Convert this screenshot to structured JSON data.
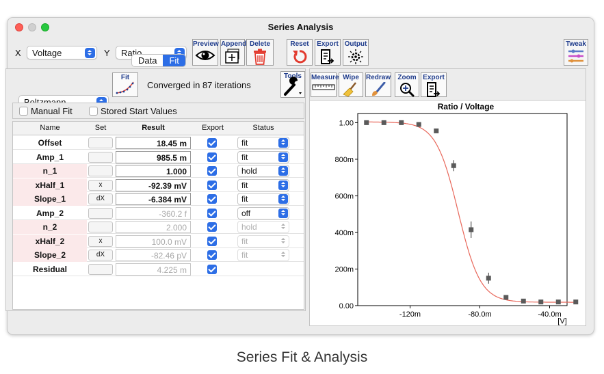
{
  "window": {
    "title": "Series Analysis"
  },
  "axes_select": {
    "x_label": "X",
    "x_value": "Voltage",
    "y_label": "Y",
    "y_value": "Ratio"
  },
  "toolbar": {
    "preview": "Preview",
    "append": "Append",
    "delete": "Delete",
    "reset": "Reset",
    "export": "Export",
    "output": "Output",
    "tweak": "Tweak"
  },
  "tabs": [
    {
      "label": "Data",
      "active": false
    },
    {
      "label": "Fit",
      "active": true
    }
  ],
  "fit": {
    "function": "Boltzmann",
    "fit_button": "Fit",
    "status": "Converged in 87 iterations",
    "tools": "Tools",
    "manual_fit": "Manual Fit",
    "stored_start": "Stored Start Values"
  },
  "table": {
    "headers": {
      "name": "Name",
      "set": "Set",
      "result": "Result",
      "export": "Export",
      "status": "Status"
    },
    "rows": [
      {
        "name": "Offset",
        "set": "",
        "result": "18.45 m",
        "export": true,
        "status": "fit",
        "dim": false,
        "pink": false
      },
      {
        "name": "Amp_1",
        "set": "",
        "result": "985.5 m",
        "export": true,
        "status": "fit",
        "dim": false,
        "pink": false
      },
      {
        "name": "n_1",
        "set": "",
        "result": "1.000",
        "export": true,
        "status": "hold",
        "dim": false,
        "pink": true
      },
      {
        "name": "xHalf_1",
        "set": "x",
        "result": "-92.39 mV",
        "export": true,
        "status": "fit",
        "dim": false,
        "pink": true
      },
      {
        "name": "Slope_1",
        "set": "dX",
        "result": "-6.384 mV",
        "export": true,
        "status": "fit",
        "dim": false,
        "pink": true
      },
      {
        "name": "Amp_2",
        "set": "",
        "result": "-360.2 f",
        "export": true,
        "status": "off",
        "dim": true,
        "pink": false
      },
      {
        "name": "n_2",
        "set": "",
        "result": "2.000",
        "export": true,
        "status": "hold",
        "dim": true,
        "pink": true
      },
      {
        "name": "xHalf_2",
        "set": "x",
        "result": "100.0 mV",
        "export": true,
        "status": "fit",
        "dim": true,
        "pink": true
      },
      {
        "name": "Slope_2",
        "set": "dX",
        "result": "-82.46 pV",
        "export": true,
        "status": "fit",
        "dim": true,
        "pink": true
      },
      {
        "name": "Residual",
        "set": "",
        "result": "4.225 m",
        "export": true,
        "status": "",
        "dim": true,
        "pink": false
      }
    ]
  },
  "graph_toolbar": {
    "measure": "Measure",
    "wipe": "Wipe",
    "redraw": "Redraw",
    "zoom": "Zoom",
    "export": "Export"
  },
  "chart_data": {
    "type": "scatter",
    "title": "Ratio / Voltage",
    "xlabel": "",
    "x_unit": "[V]",
    "ylabel": "",
    "xlim": [
      -0.15,
      -0.03
    ],
    "ylim": [
      0.0,
      1.05
    ],
    "x_ticks": [
      {
        "v": -0.12,
        "label": "-120m"
      },
      {
        "v": -0.08,
        "label": "-80.0m"
      },
      {
        "v": -0.04,
        "label": "-40.0m"
      }
    ],
    "y_ticks": [
      {
        "v": 0.0,
        "label": "0.00"
      },
      {
        "v": 0.2,
        "label": "200m"
      },
      {
        "v": 0.4,
        "label": "400m"
      },
      {
        "v": 0.6,
        "label": "600m"
      },
      {
        "v": 0.8,
        "label": "800m"
      },
      {
        "v": 1.0,
        "label": "1.00"
      }
    ],
    "points": [
      {
        "x": -0.145,
        "y": 1.0,
        "err": 0
      },
      {
        "x": -0.135,
        "y": 1.0,
        "err": 0
      },
      {
        "x": -0.125,
        "y": 1.0,
        "err": 0
      },
      {
        "x": -0.115,
        "y": 0.99,
        "err": 0
      },
      {
        "x": -0.105,
        "y": 0.955,
        "err": 0
      },
      {
        "x": -0.095,
        "y": 0.765,
        "err": 0.03
      },
      {
        "x": -0.085,
        "y": 0.415,
        "err": 0.045
      },
      {
        "x": -0.075,
        "y": 0.15,
        "err": 0.03
      },
      {
        "x": -0.065,
        "y": 0.045,
        "err": 0
      },
      {
        "x": -0.055,
        "y": 0.025,
        "err": 0
      },
      {
        "x": -0.045,
        "y": 0.02,
        "err": 0
      },
      {
        "x": -0.035,
        "y": 0.02,
        "err": 0
      },
      {
        "x": -0.025,
        "y": 0.02,
        "err": 0
      }
    ],
    "fit_curve": {
      "offset": 0.01845,
      "amp": 0.9855,
      "xhalf": -0.09239,
      "slope": -0.006384,
      "color": "#e8675a"
    },
    "marker_color": "#5a5a5a",
    "grid": false
  },
  "caption": "Series Fit & Analysis"
}
